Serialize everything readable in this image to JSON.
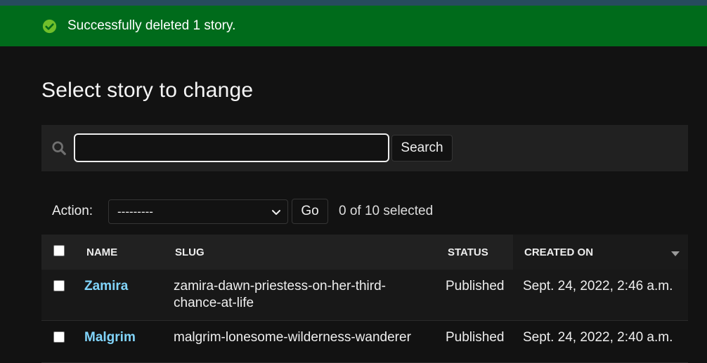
{
  "message": {
    "text": "Successfully deleted 1 story.",
    "icon": "check-circle-icon",
    "color": "#006b1b"
  },
  "title": "Select story to change",
  "search": {
    "value": "",
    "placeholder": "",
    "button_label": "Search",
    "icon": "search-icon"
  },
  "actions": {
    "label": "Action:",
    "selected": "---------",
    "go_label": "Go",
    "selection_count": "0 of 10 selected"
  },
  "table": {
    "columns": [
      "Name",
      "Slug",
      "Status",
      "Created on"
    ],
    "rows": [
      {
        "name": "Zamira",
        "slug_line1": "zamira-dawn-priestess-on-her-third-",
        "slug_line2": "chance-at-life",
        "status": "Published",
        "created_on": "Sept. 24, 2022, 2:46 a.m."
      },
      {
        "name": "Malgrim",
        "slug_line1": "malgrim-lonesome-wilderness-wanderer",
        "slug_line2": "",
        "status": "Published",
        "created_on": "Sept. 24, 2022, 2:40 a.m."
      }
    ]
  },
  "colors": {
    "link": "#81d4fa",
    "success": "#006b1b",
    "header_stripe": "#264b5d"
  }
}
